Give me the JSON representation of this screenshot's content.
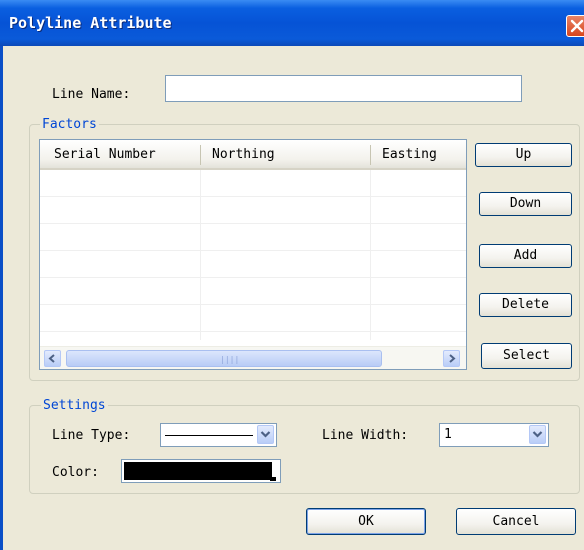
{
  "window": {
    "title": "Polyline Attribute"
  },
  "line_name": {
    "label": "Line Name:",
    "value": ""
  },
  "factors": {
    "legend": "Factors",
    "columns": [
      "Serial Number",
      "Northing",
      "Easting"
    ],
    "rows": [],
    "buttons": {
      "up": "Up",
      "down": "Down",
      "add": "Add",
      "delete": "Delete",
      "select": "Select"
    }
  },
  "settings": {
    "legend": "Settings",
    "line_type_label": "Line Type:",
    "line_type_value": "solid",
    "line_width_label": "Line Width:",
    "line_width_value": "1",
    "color_label": "Color:",
    "color_value": "#000000"
  },
  "footer": {
    "ok": "OK",
    "cancel": "Cancel"
  },
  "colors": {
    "title_bar": "#0653D6",
    "group_legend": "#0046D5",
    "dialog_bg": "#ECE9D8"
  },
  "icons": {
    "close": "close-icon",
    "combo": "chevron-down-icon",
    "scroll_left": "arrow-left-icon",
    "scroll_right": "arrow-right-icon"
  }
}
